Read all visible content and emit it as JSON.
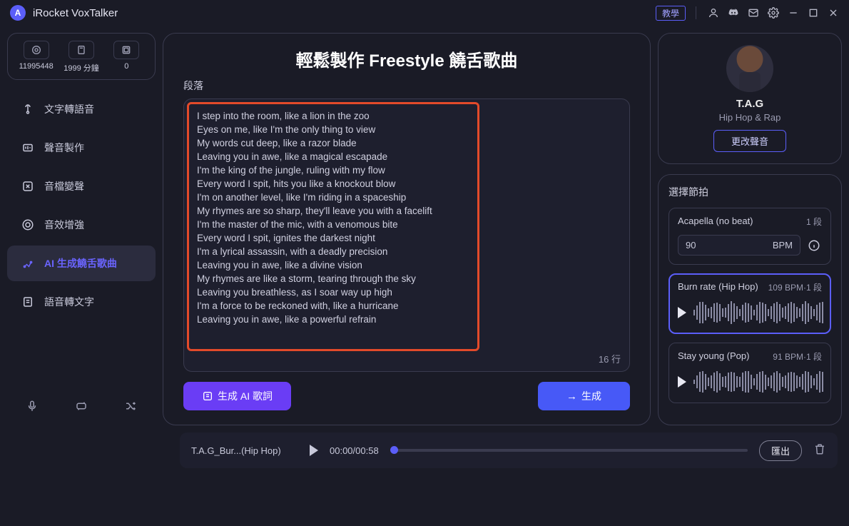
{
  "app": {
    "name": "iRocket VoxTalker",
    "tutorial": "教學"
  },
  "stats": {
    "points": "11995448",
    "minutes": "1999 分鐘",
    "projects": "0"
  },
  "nav": {
    "tts": "文字轉語音",
    "voice_lab": "聲音製作",
    "voice_change": "音檔變聲",
    "enhance": "音效增強",
    "rap": "AI 生成饒舌歌曲",
    "stt": "語音轉文字"
  },
  "center": {
    "title": "輕鬆製作 Freestyle 饒舌歌曲",
    "section_label": "段落",
    "lyrics": "I step into the room, like a lion in the zoo\nEyes on me, like I'm the only thing to view\nMy words cut deep, like a razor blade\nLeaving you in awe, like a magical escapade\nI'm the king of the jungle, ruling with my flow\nEvery word I spit, hits you like a knockout blow\nI'm on another level, like I'm riding in a spaceship\nMy rhymes are so sharp, they'll leave you with a facelift\nI'm the master of the mic, with a venomous bite\nEvery word I spit, ignites the darkest night\nI'm a lyrical assassin, with a deadly precision\nLeaving you in awe, like a divine vision\nMy rhymes are like a storm, tearing through the sky\nLeaving you breathless, as I soar way up high\nI'm a force to be reckoned with, like a hurricane\nLeaving you in awe, like a powerful refrain",
    "line_count": "16 行",
    "gen_lyrics_btn": "生成 AI 歌詞",
    "generate_btn": "生成"
  },
  "voice": {
    "name": "T.A.G",
    "genre": "Hip Hop & Rap",
    "change_btn": "更改聲音"
  },
  "beats": {
    "title": "選擇節拍",
    "items": [
      {
        "name": "Acapella (no beat)",
        "meta": "1 段",
        "bpm_value": "90",
        "bpm_label": "BPM"
      },
      {
        "name": "Burn rate (Hip Hop)",
        "meta": "109 BPM·1 段"
      },
      {
        "name": "Stay young (Pop)",
        "meta": "91 BPM·1 段"
      }
    ]
  },
  "player": {
    "track": "T.A.G_Bur...(Hip Hop)",
    "time": "00:00/00:58",
    "export": "匯出"
  }
}
